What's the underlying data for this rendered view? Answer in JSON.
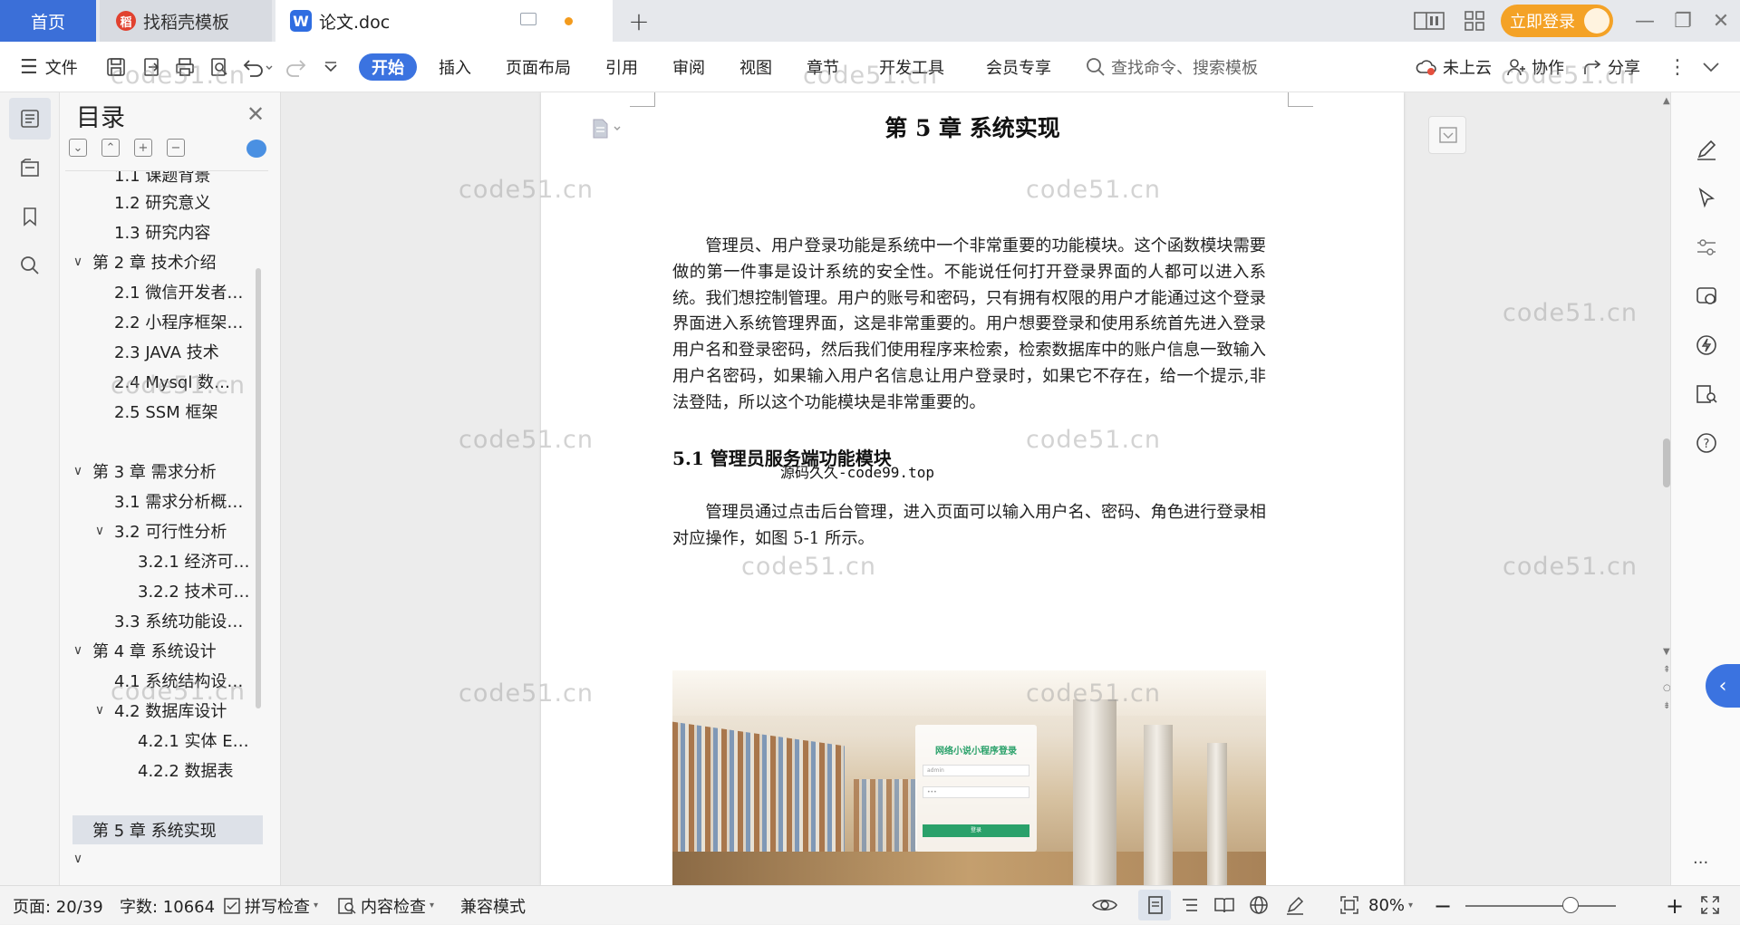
{
  "tabs": {
    "home": "首页",
    "template": "找稻壳模板",
    "doc": "论文.doc",
    "login": "立即登录"
  },
  "ribbon": {
    "file": "文件",
    "menus": [
      "开始",
      "插入",
      "页面布局",
      "引用",
      "审阅",
      "视图",
      "章节",
      "开发工具",
      "会员专享"
    ],
    "search_placeholder": "查找命令、搜索模板",
    "cloud": "未上云",
    "collab": "协作",
    "share": "分享"
  },
  "outline": {
    "title": "目录",
    "items": [
      {
        "label": "1.1 课题背景",
        "level": 2,
        "toggle": ""
      },
      {
        "label": "1.2 研究意义",
        "level": 2,
        "toggle": ""
      },
      {
        "label": "1.3 研究内容",
        "level": 2,
        "toggle": ""
      },
      {
        "label": "第 2 章  技术介绍",
        "level": 1,
        "toggle": "∨"
      },
      {
        "label": "2.1 微信开发者…",
        "level": 2,
        "toggle": ""
      },
      {
        "label": "2.2 小程序框架…",
        "level": 2,
        "toggle": ""
      },
      {
        "label": "2.3 JAVA 技术",
        "level": 2,
        "toggle": ""
      },
      {
        "label": "2.4   Mysql 数…",
        "level": 2,
        "toggle": ""
      },
      {
        "label": "2.5 SSM 框架",
        "level": 2,
        "toggle": ""
      },
      {
        "label": "第 3 章  需求分析",
        "level": 1,
        "toggle": "∨"
      },
      {
        "label": "3.1 需求分析概…",
        "level": 2,
        "toggle": ""
      },
      {
        "label": "3.2 可行性分析",
        "level": 2,
        "toggle": "∨"
      },
      {
        "label": "3.2.1 经济可…",
        "level": 3,
        "toggle": ""
      },
      {
        "label": "3.2.2 技术可…",
        "level": 3,
        "toggle": ""
      },
      {
        "label": "3.3 系统功能设…",
        "level": 2,
        "toggle": ""
      },
      {
        "label": "第 4 章  系统设计",
        "level": 1,
        "toggle": "∨"
      },
      {
        "label": "4.1 系统结构设…",
        "level": 2,
        "toggle": ""
      },
      {
        "label": "4.2 数据库设计",
        "level": 2,
        "toggle": "∨"
      },
      {
        "label": "4.2.1 实体 E…",
        "level": 3,
        "toggle": ""
      },
      {
        "label": "4.2.2 数据表",
        "level": 3,
        "toggle": ""
      },
      {
        "label": "第 5 章  系统实现",
        "level": 1,
        "toggle": "",
        "selected": true
      },
      {
        "label": "",
        "level": 1,
        "toggle": "∨"
      }
    ]
  },
  "document": {
    "chapter_title": "第 5 章  系统实现",
    "para1": "管理员、用户登录功能是系统中一个非常重要的功能模块。这个函数模块需要做的第一件事是设计系统的安全性。不能说任何打开登录界面的人都可以进入系统。我们想控制管理。用户的账号和密码，只有拥有权限的用户才能通过这个登录界面进入系统管理界面，这是非常重要的。用户想要登录和使用系统首先进入登录用户名和登录密码，然后我们使用程序来检索，检索数据库中的账户信息一致输入用户名密码，如果输入用户名信息让用户登录时，如果它不存在，给一个提示,非法登陆，所以这个功能模块是非常重要的。",
    "section_title": "5.1 管理员服务端功能模块",
    "overlay_text": "源码久久-code99.top",
    "para2": "管理员通过点击后台管理，进入页面可以输入用户名、密码、角色进行登录相对应操作，如图 5-1 所示。",
    "figure": {
      "login_title": "网络小说小程序登录",
      "field_user": "admin",
      "field_pass": "•••",
      "button": "登录"
    }
  },
  "watermark": "code51.cn",
  "status": {
    "page": "页面: 20/39",
    "words": "字数: 10664",
    "spell": "拼写检查",
    "content": "内容检查",
    "compat": "兼容模式",
    "zoom": "80%",
    "zoom_level": 0.4
  }
}
